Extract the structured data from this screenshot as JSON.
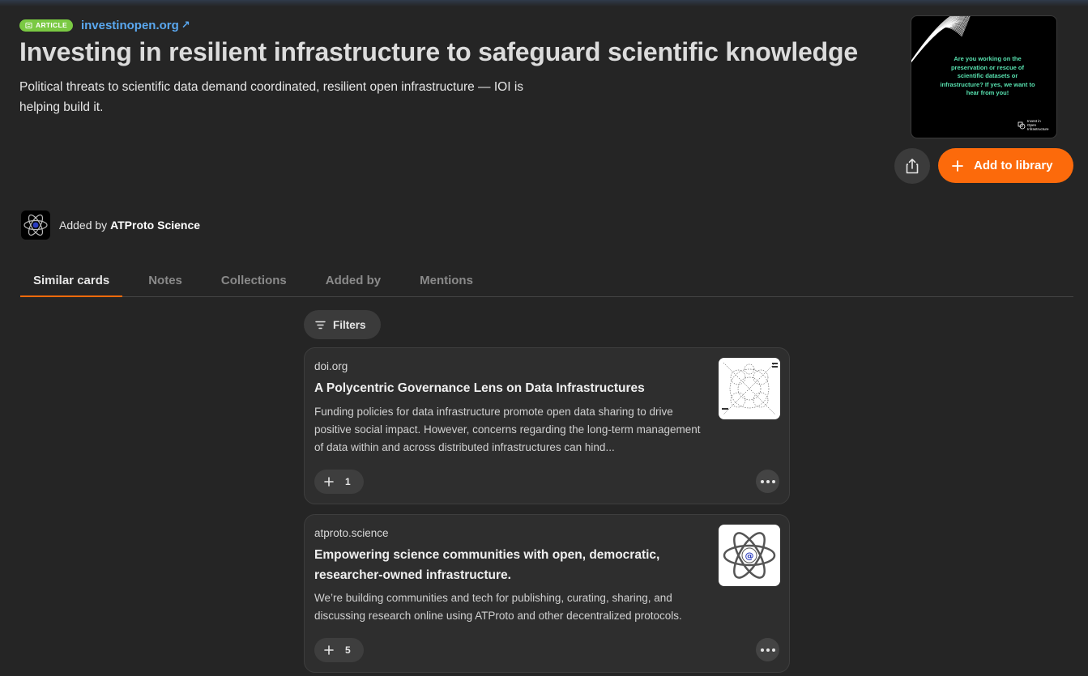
{
  "article": {
    "badge": "ARTICLE",
    "source": "investinopen.org",
    "title": "Investing in resilient infrastructure to safeguard scientific knowledge",
    "description": "Political threats to scientific data demand coordinated, resilient open infrastructure — IOI is helping build it.",
    "thumbnail": {
      "text": "Are you working on the preservation or rescue of scientific datasets or infrastructure? If yes, we want to hear from you!",
      "logo_text": "Invest in Open Infrastructure"
    }
  },
  "actions": {
    "share_icon": "share-icon",
    "add_label": "Add to library"
  },
  "added_by": {
    "prefix": "Added by",
    "name": "ATProto Science"
  },
  "tabs": [
    {
      "label": "Similar cards",
      "active": true
    },
    {
      "label": "Notes",
      "active": false
    },
    {
      "label": "Collections",
      "active": false
    },
    {
      "label": "Added by",
      "active": false
    },
    {
      "label": "Mentions",
      "active": false
    }
  ],
  "filters_label": "Filters",
  "cards": [
    {
      "source": "doi.org",
      "title": "A Polycentric Governance Lens on Data Infrastructures",
      "description": "Funding policies for data infrastructure promote open data sharing to drive positive social impact. However, concerns regarding the long-term management of data within and across distributed infrastructures can hind...",
      "count": "1"
    },
    {
      "source": "atproto.science",
      "title": "Empowering science communities with open, democratic, researcher-owned infrastructure.",
      "description": "We’re building communities and tech for publishing, curating, sharing, and discussing research online using ATProto and other decentralized protocols.",
      "count": "5"
    }
  ],
  "colors": {
    "accent": "#fc6a0b",
    "badge": "#7ac943",
    "link": "#5aa8f0",
    "background": "#252525",
    "thumb_text": "#58e2b0"
  }
}
